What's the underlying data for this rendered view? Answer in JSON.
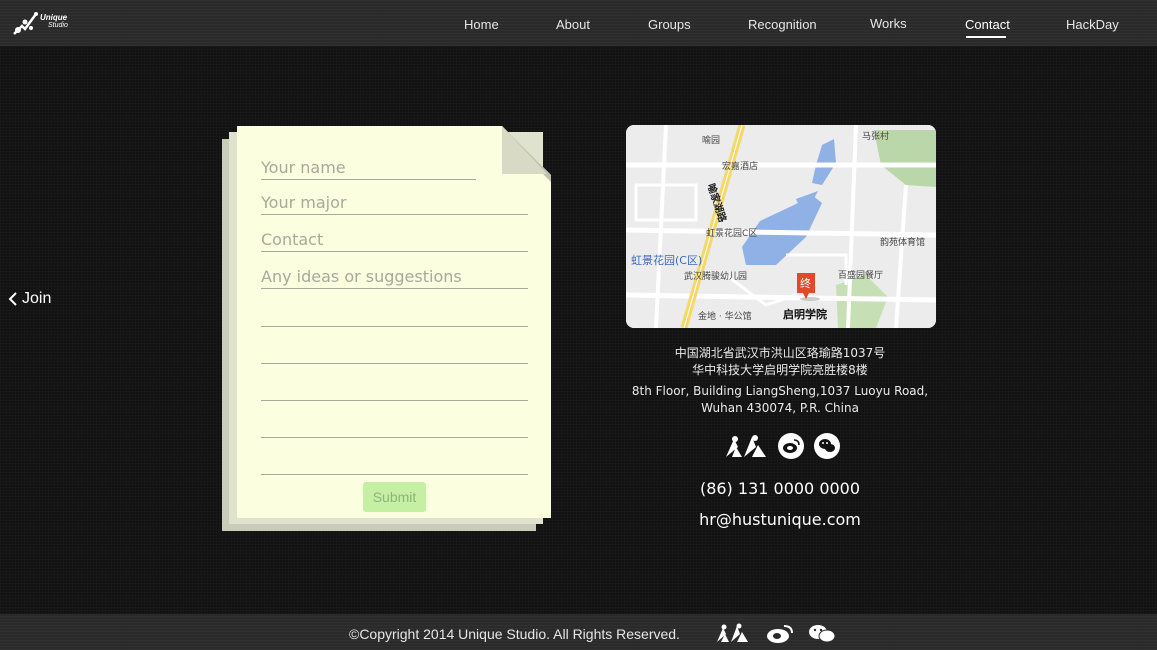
{
  "header": {
    "logo": {
      "line1": "Unique",
      "line2": "Studio"
    },
    "nav": [
      {
        "label": "Home"
      },
      {
        "label": "About"
      },
      {
        "label": "Groups"
      },
      {
        "label": "Recognition"
      },
      {
        "label": "Works"
      },
      {
        "label": "Contact",
        "active": true
      },
      {
        "label": "HackDay"
      }
    ]
  },
  "join": {
    "label": "Join",
    "icon": "chevron-left-icon"
  },
  "form": {
    "name_placeholder": "Your name",
    "major_placeholder": "Your major",
    "contact_placeholder": "Contact",
    "ideas_placeholder": "Any ideas or suggestions",
    "submit_label": "Submit"
  },
  "map": {
    "labels": {
      "yupin": "喻园",
      "hongjia_hotel": "宏嘉酒店",
      "mazhang": "马张村",
      "road": "喻家湖路",
      "hongjing_c": "虹景花园C区",
      "hongjing_c_blue": "虹景花园(C区)",
      "yunyuan_gym": "韵苑体育馆",
      "kindergarten": "武汉腾骏幼儿园",
      "restaurant": "百盛园餐厅",
      "jindi": "金地 · 华公馆",
      "qiming": "启明学院",
      "marker": "终"
    }
  },
  "contact": {
    "address_cn_1": "中国湖北省武汉市洪山区珞瑜路1037号",
    "address_cn_2": "华中科技大学启明学院亮胜楼8楼",
    "address_en_1": "8th Floor, Building LiangSheng,1037 Luoyu Road,",
    "address_en_2": "Wuhan 430074, P.R. China",
    "phone": "(86) 131 0000 0000",
    "email": "hr@hustunique.com",
    "social": [
      "renren-icon",
      "weibo-icon",
      "wechat-icon"
    ]
  },
  "footer": {
    "copyright": "©Copyright 2014 Unique Studio. All Rights Reserved.",
    "social": [
      "renren-icon",
      "weibo-icon",
      "wechat-icon"
    ]
  },
  "colors": {
    "background": "#121212",
    "bar": "#2a2a2a",
    "paper": "#fbfedf",
    "submit": "#c5f0a4",
    "map_water": "#8fb1e6",
    "map_green": "#b9d7a8",
    "map_road_yellow": "#f4d96a"
  }
}
